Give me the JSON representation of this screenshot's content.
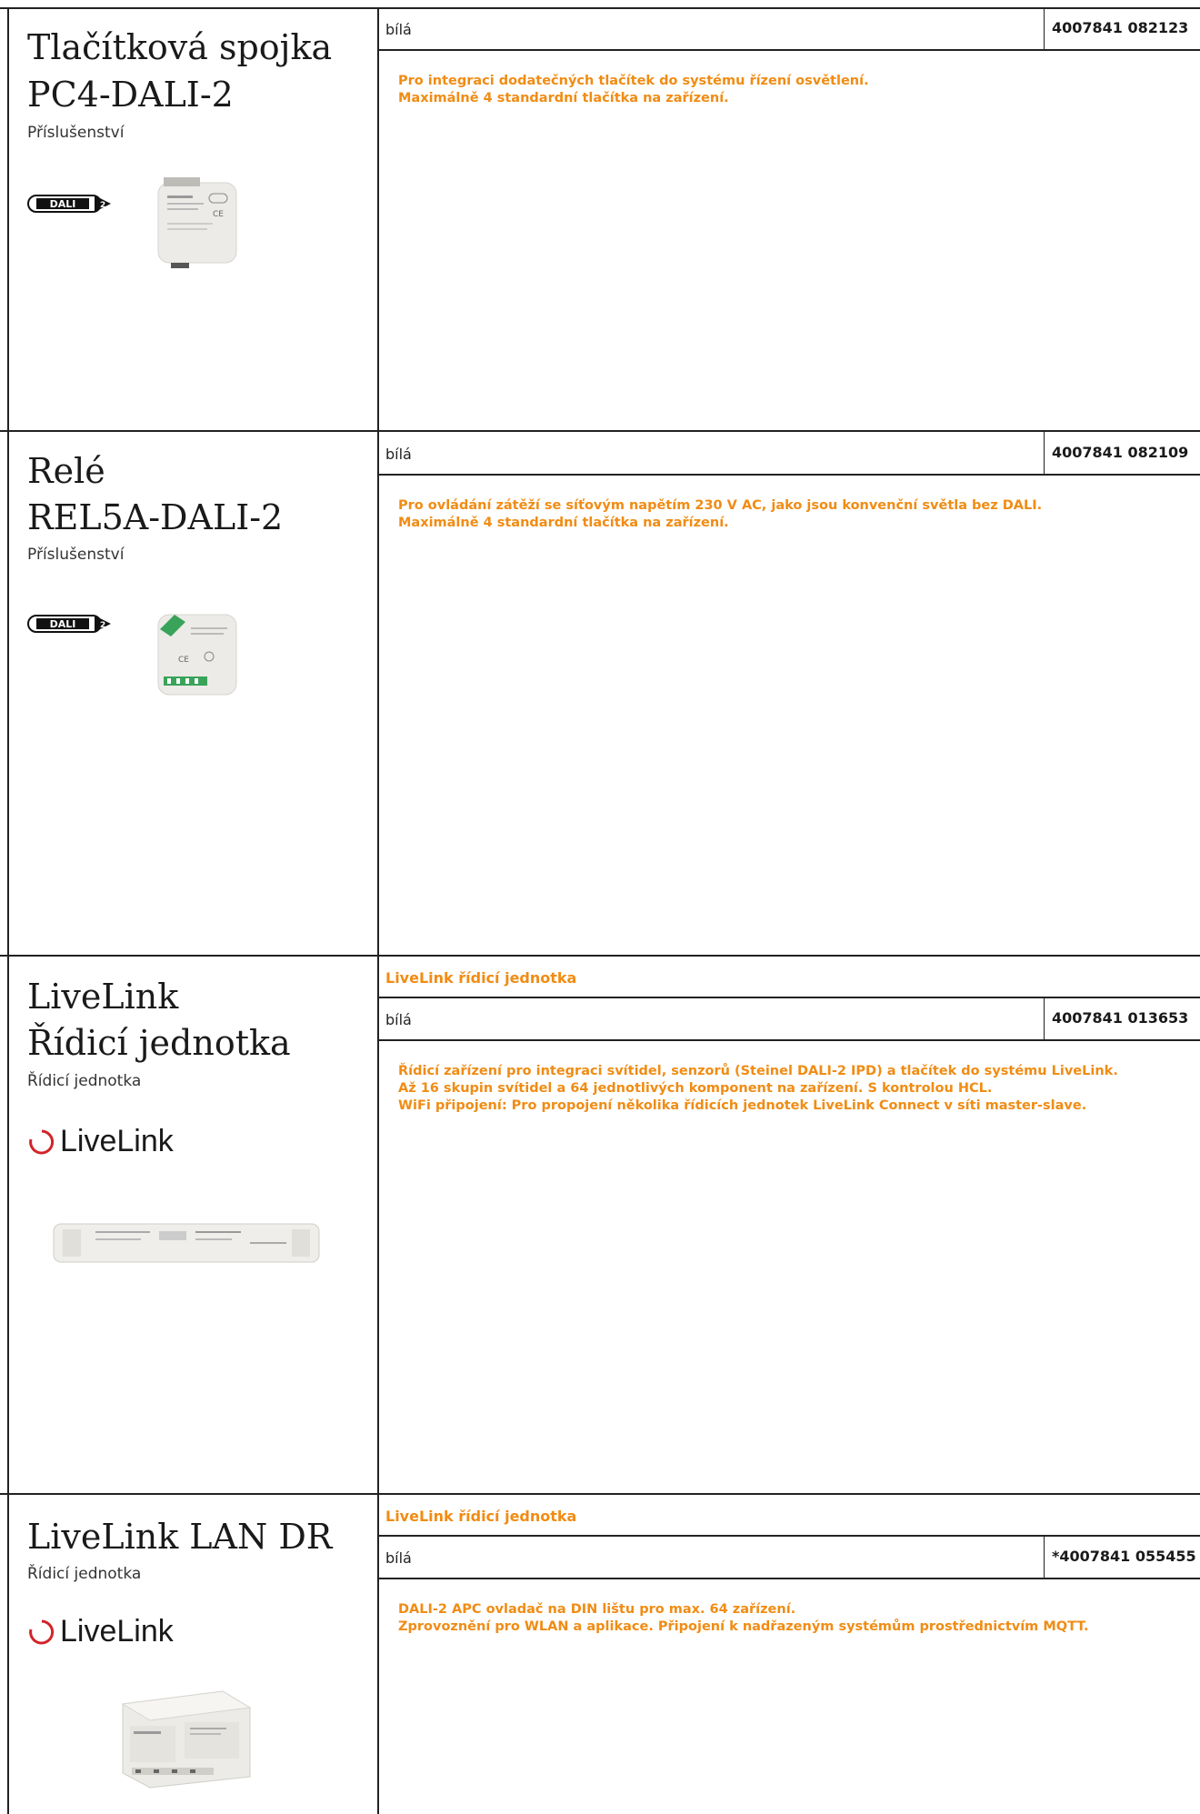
{
  "products": [
    {
      "title_lines": [
        "Tlačítková spojka",
        "PC4-DALI-2"
      ],
      "subtitle": "Příslušenství",
      "category": "",
      "color": "bílá",
      "code": "4007841 082123",
      "description": [
        "Pro integraci dodatečných tlačítek do systému řízení osvětlení.",
        "Maximálně 4 standardní tlačítka na zařízení."
      ],
      "badge": "DALI-2",
      "image": "push-button-coupler-image"
    },
    {
      "title_lines": [
        "Relé",
        "REL5A-DALI-2"
      ],
      "subtitle": "Příslušenství",
      "category": "",
      "color": "bílá",
      "code": "4007841 082109",
      "description": [
        "Pro ovládání zátěží se síťovým napětím 230 V AC, jako jsou konvenční světla bez DALI.",
        "Maximálně 4 standardní tlačítka na zařízení."
      ],
      "badge": "DALI-2",
      "image": "relay-module-image"
    },
    {
      "title_lines": [
        "LiveLink",
        "Řídicí jednotka"
      ],
      "subtitle": "Řídicí jednotka",
      "category": "LiveLink řídicí jednotka",
      "color": "bílá",
      "code": "4007841 013653",
      "description": [
        "Řídicí zařízení pro integraci svítidel, senzorů (Steinel DALI-2 IPD) a tlačítek do systému LiveLink.",
        "Až 16 skupin svítidel a 64 jednotlivých komponent na zařízení. S kontrolou HCL.",
        "WiFi připojení: Pro propojení několika řídicích jednotek LiveLink Connect v síti master-slave."
      ],
      "brand": "LiveLink",
      "image": "control-unit-image"
    },
    {
      "title_lines": [
        "LiveLink LAN DR"
      ],
      "subtitle": "Řídicí jednotka",
      "category": "LiveLink řídicí jednotka",
      "color": "bílá",
      "code": "*4007841 055455",
      "description": [
        "DALI-2 APC ovladač na DIN lištu pro max. 64 zařízení.",
        "Zprovoznění pro WLAN a aplikace. Připojení k nadřazeným systémům prostřednictvím MQTT."
      ],
      "brand": "LiveLink",
      "image": "din-rail-controller-image"
    }
  ],
  "colors": {
    "accent": "#f08c14",
    "lines": "#222222",
    "brand_ring": "#d2232a"
  }
}
